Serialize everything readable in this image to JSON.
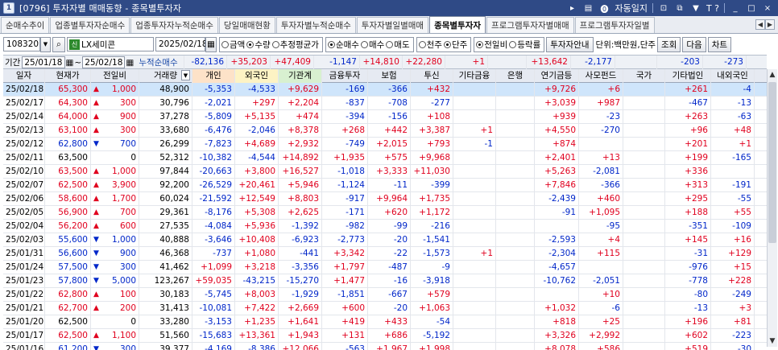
{
  "window": {
    "code": "[0796]",
    "title": "투자자별 매매동향 - 종목별투자자",
    "right_icons": [
      "play-icon",
      "list-icon",
      "help-circle-icon",
      "minimize-icon",
      "maximize-icon",
      "close-icon"
    ],
    "auto_save_label": "자동일지",
    "right_extra": "T ?"
  },
  "tabs": [
    {
      "label": "순매수추이"
    },
    {
      "label": "업종별투자자순매수"
    },
    {
      "label": "업종투자자누적순매수"
    },
    {
      "label": "당일매매현황"
    },
    {
      "label": "투자자별누적순매수"
    },
    {
      "label": "투자자별일별매매"
    },
    {
      "label": "종목별투자자",
      "active": true
    },
    {
      "label": "프로그램투자자별매매"
    },
    {
      "label": "프로그램투자자일별"
    }
  ],
  "controls": {
    "stock_code": "108320",
    "stock_name": "LX세미콘",
    "stock_badge": "신",
    "date": "2025/02/18",
    "radio_group1": [
      {
        "label": "금액",
        "on": false
      },
      {
        "label": "수량",
        "on": true
      },
      {
        "label": "추정평균가",
        "on": false
      }
    ],
    "radio_group2": [
      {
        "label": "순매수",
        "on": true
      },
      {
        "label": "매수",
        "on": false
      },
      {
        "label": "매도",
        "on": false
      }
    ],
    "radio_group3": [
      {
        "label": "천주",
        "on": false
      },
      {
        "label": "단주",
        "on": true
      }
    ],
    "radio_group4": [
      {
        "label": "전일비",
        "on": true
      },
      {
        "label": "등락률",
        "on": false
      }
    ],
    "guide_button": "투자자안내",
    "unit_label": "단위:백만원,단주",
    "query_button": "조회",
    "next_button": "다음",
    "chart_button": "차트"
  },
  "period": {
    "label": "기간",
    "from": "25/01/18",
    "to": "25/02/18",
    "summary_label": "누적순매수",
    "values": [
      "-82,136",
      "+35,203",
      "+47,409",
      "-1,147",
      "+14,810",
      "+22,280",
      "+1",
      "",
      "+13,642",
      "-2,177",
      "",
      "-203",
      "-273"
    ]
  },
  "headers": [
    "일자",
    "현재가",
    "전일비",
    "거래량",
    "개인",
    "외국인",
    "기관계",
    "금융투자",
    "보험",
    "투신",
    "기타금융",
    "은행",
    "연기금등",
    "사모펀드",
    "국가",
    "기타법인",
    "내외국인"
  ],
  "rows": [
    {
      "date": "25/02/18",
      "price": "65,300",
      "dir": "up",
      "chg": "1,000",
      "vol": "48,900",
      "v": [
        "-5,353",
        "-4,533",
        "+9,629",
        "-169",
        "-366",
        "+432",
        "",
        "",
        "+9,726",
        "+6",
        "",
        "+261",
        "-4"
      ],
      "highlight": true
    },
    {
      "date": "25/02/17",
      "price": "64,300",
      "dir": "up",
      "chg": "300",
      "vol": "30,796",
      "v": [
        "-2,021",
        "+297",
        "+2,204",
        "-837",
        "-708",
        "-277",
        "",
        "",
        "+3,039",
        "+987",
        "",
        "-467",
        "-13"
      ]
    },
    {
      "date": "25/02/14",
      "price": "64,000",
      "dir": "up",
      "chg": "900",
      "vol": "37,278",
      "v": [
        "-5,809",
        "+5,135",
        "+474",
        "-394",
        "-156",
        "+108",
        "",
        "",
        "+939",
        "-23",
        "",
        "+263",
        "-63"
      ]
    },
    {
      "date": "25/02/13",
      "price": "63,100",
      "dir": "up",
      "chg": "300",
      "vol": "33,680",
      "v": [
        "-6,476",
        "-2,046",
        "+8,378",
        "+268",
        "+442",
        "+3,387",
        "+1",
        "",
        "+4,550",
        "-270",
        "",
        "+96",
        "+48"
      ]
    },
    {
      "date": "25/02/12",
      "price": "62,800",
      "dir": "down",
      "chg": "700",
      "vol": "26,299",
      "v": [
        "-7,823",
        "+4,689",
        "+2,932",
        "-749",
        "+2,015",
        "+793",
        "-1",
        "",
        "+874",
        "",
        "",
        "+201",
        "+1"
      ]
    },
    {
      "date": "25/02/11",
      "price": "63,500",
      "dir": "",
      "chg": "0",
      "vol": "52,312",
      "v": [
        "-10,382",
        "-4,544",
        "+14,892",
        "+1,935",
        "+575",
        "+9,968",
        "",
        "",
        "+2,401",
        "+13",
        "",
        "+199",
        "-165"
      ]
    },
    {
      "date": "25/02/10",
      "price": "63,500",
      "dir": "up",
      "chg": "1,000",
      "vol": "97,844",
      "v": [
        "-20,663",
        "+3,800",
        "+16,527",
        "-1,018",
        "+3,333",
        "+11,030",
        "",
        "",
        "+5,263",
        "-2,081",
        "",
        "+336",
        ""
      ]
    },
    {
      "date": "25/02/07",
      "price": "62,500",
      "dir": "up",
      "chg": "3,900",
      "vol": "92,200",
      "v": [
        "-26,529",
        "+20,461",
        "+5,946",
        "-1,124",
        "-11",
        "-399",
        "",
        "",
        "+7,846",
        "-366",
        "",
        "+313",
        "-191"
      ]
    },
    {
      "date": "25/02/06",
      "price": "58,600",
      "dir": "up",
      "chg": "1,700",
      "vol": "60,024",
      "v": [
        "-21,592",
        "+12,549",
        "+8,803",
        "-917",
        "+9,964",
        "+1,735",
        "",
        "",
        "-2,439",
        "+460",
        "",
        "+295",
        "-55"
      ]
    },
    {
      "date": "25/02/05",
      "price": "56,900",
      "dir": "up",
      "chg": "700",
      "vol": "29,361",
      "v": [
        "-8,176",
        "+5,308",
        "+2,625",
        "-171",
        "+620",
        "+1,172",
        "",
        "",
        "-91",
        "+1,095",
        "",
        "+188",
        "+55"
      ]
    },
    {
      "date": "25/02/04",
      "price": "56,200",
      "dir": "up",
      "chg": "600",
      "vol": "27,535",
      "v": [
        "-4,084",
        "+5,936",
        "-1,392",
        "-982",
        "-99",
        "-216",
        "",
        "",
        "",
        "-95",
        "",
        "-351",
        "-109"
      ]
    },
    {
      "date": "25/02/03",
      "price": "55,600",
      "dir": "down",
      "chg": "1,000",
      "vol": "40,888",
      "v": [
        "-3,646",
        "+10,408",
        "-6,923",
        "-2,773",
        "-20",
        "-1,541",
        "",
        "",
        "-2,593",
        "+4",
        "",
        "+145",
        "+16"
      ]
    },
    {
      "date": "25/01/31",
      "price": "56,600",
      "dir": "down",
      "chg": "900",
      "vol": "46,368",
      "v": [
        "-737",
        "+1,080",
        "-441",
        "+3,342",
        "-22",
        "-1,573",
        "+1",
        "",
        "-2,304",
        "+115",
        "",
        "-31",
        "+129"
      ]
    },
    {
      "date": "25/01/24",
      "price": "57,500",
      "dir": "down",
      "chg": "300",
      "vol": "41,462",
      "v": [
        "+1,099",
        "+3,218",
        "-3,356",
        "+1,797",
        "-487",
        "-9",
        "",
        "",
        "-4,657",
        "",
        "",
        "-976",
        "+15"
      ]
    },
    {
      "date": "25/01/23",
      "price": "57,800",
      "dir": "down",
      "chg": "5,000",
      "vol": "123,267",
      "v": [
        "+59,035",
        "-43,215",
        "-15,270",
        "+1,477",
        "-16",
        "-3,918",
        "",
        "",
        "-10,762",
        "-2,051",
        "",
        "-778",
        "+228"
      ]
    },
    {
      "date": "25/01/22",
      "price": "62,800",
      "dir": "up",
      "chg": "100",
      "vol": "30,183",
      "v": [
        "-5,745",
        "+8,003",
        "-1,929",
        "-1,851",
        "-667",
        "+579",
        "",
        "",
        "",
        "+10",
        "",
        "-80",
        "-249"
      ]
    },
    {
      "date": "25/01/21",
      "price": "62,700",
      "dir": "up",
      "chg": "200",
      "vol": "31,413",
      "v": [
        "-10,081",
        "+7,422",
        "+2,669",
        "+600",
        "-20",
        "+1,063",
        "",
        "",
        "+1,032",
        "-6",
        "",
        "-13",
        "+3"
      ]
    },
    {
      "date": "25/01/20",
      "price": "62,500",
      "dir": "",
      "chg": "0",
      "vol": "33,280",
      "v": [
        "-3,153",
        "+1,235",
        "+1,641",
        "+419",
        "+433",
        "-54",
        "",
        "",
        "+818",
        "+25",
        "",
        "+196",
        "+81"
      ]
    },
    {
      "date": "25/01/17",
      "price": "62,500",
      "dir": "up",
      "chg": "1,100",
      "vol": "51,560",
      "v": [
        "-15,683",
        "+13,361",
        "+1,943",
        "+131",
        "+686",
        "-5,192",
        "",
        "",
        "+3,326",
        "+2,992",
        "",
        "+602",
        "-223"
      ]
    },
    {
      "date": "25/01/16",
      "price": "61,200",
      "dir": "down",
      "chg": "300",
      "vol": "39,377",
      "v": [
        "-4,169",
        "-8,386",
        "+12,066",
        "-563",
        "+1,967",
        "+1,998",
        "",
        "",
        "+8,078",
        "+586",
        "",
        "+519",
        "-30"
      ]
    }
  ],
  "colors": {
    "up": "#e0001e",
    "down": "#0026c9",
    "header_bg": "#e6eaf2",
    "selected_row": "#cfe5fb",
    "title_bar": "#2f4a86"
  }
}
